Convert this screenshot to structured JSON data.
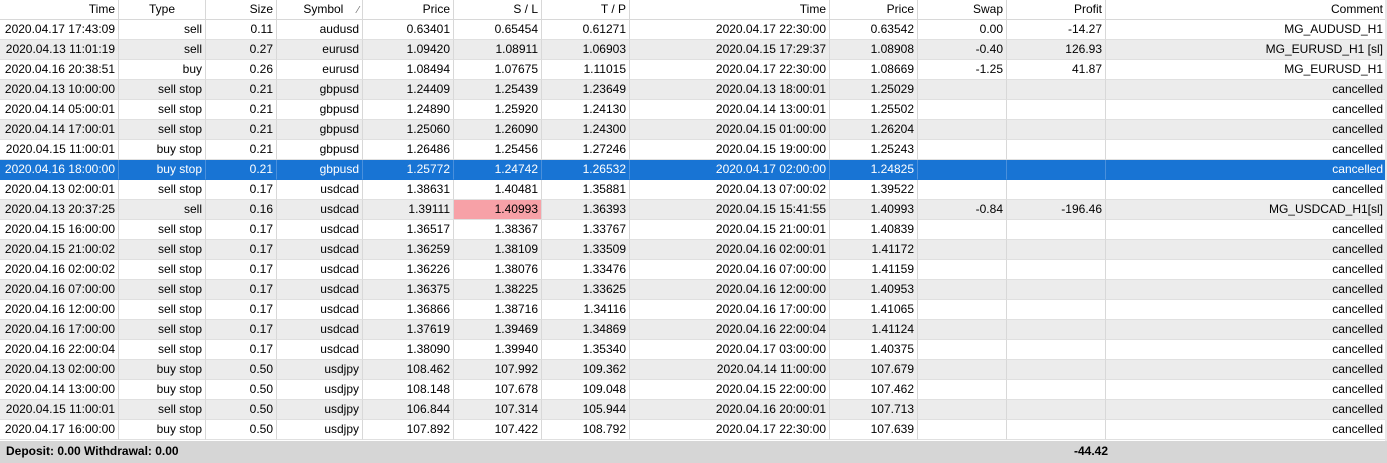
{
  "columns": [
    {
      "label": "Time",
      "w": 119
    },
    {
      "label": "Type",
      "w": 87
    },
    {
      "label": "Size",
      "w": 71
    },
    {
      "label": "Symbol",
      "w": 86
    },
    {
      "label": "Price",
      "w": 91
    },
    {
      "label": "S / L",
      "w": 88
    },
    {
      "label": "T / P",
      "w": 88
    },
    {
      "label": "Time",
      "w": 200
    },
    {
      "label": "Price",
      "w": 88
    },
    {
      "label": "Swap",
      "w": 89
    },
    {
      "label": "Profit",
      "w": 99
    },
    {
      "label": "Comment",
      "w": 281
    }
  ],
  "sort_indicator": "⁄",
  "rows": [
    [
      "2020.04.17 17:43:09",
      "sell",
      "0.11",
      "audusd",
      "0.63401",
      "0.65454",
      "0.61271",
      "2020.04.17 22:30:00",
      "0.63542",
      "0.00",
      "-14.27",
      "MG_AUDUSD_H1"
    ],
    [
      "2020.04.13 11:01:19",
      "sell",
      "0.27",
      "eurusd",
      "1.09420",
      "1.08911",
      "1.06903",
      "2020.04.15 17:29:37",
      "1.08908",
      "-0.40",
      "126.93",
      "MG_EURUSD_H1 [sl]"
    ],
    [
      "2020.04.16 20:38:51",
      "buy",
      "0.26",
      "eurusd",
      "1.08494",
      "1.07675",
      "1.11015",
      "2020.04.17 22:30:00",
      "1.08669",
      "-1.25",
      "41.87",
      "MG_EURUSD_H1"
    ],
    [
      "2020.04.13 10:00:00",
      "sell stop",
      "0.21",
      "gbpusd",
      "1.24409",
      "1.25439",
      "1.23649",
      "2020.04.13 18:00:01",
      "1.25029",
      "",
      "",
      "cancelled"
    ],
    [
      "2020.04.14 05:00:01",
      "sell stop",
      "0.21",
      "gbpusd",
      "1.24890",
      "1.25920",
      "1.24130",
      "2020.04.14 13:00:01",
      "1.25502",
      "",
      "",
      "cancelled"
    ],
    [
      "2020.04.14 17:00:01",
      "sell stop",
      "0.21",
      "gbpusd",
      "1.25060",
      "1.26090",
      "1.24300",
      "2020.04.15 01:00:00",
      "1.26204",
      "",
      "",
      "cancelled"
    ],
    [
      "2020.04.15 11:00:01",
      "buy stop",
      "0.21",
      "gbpusd",
      "1.26486",
      "1.25456",
      "1.27246",
      "2020.04.15 19:00:00",
      "1.25243",
      "",
      "",
      "cancelled"
    ],
    [
      "2020.04.16 18:00:00",
      "buy stop",
      "0.21",
      "gbpusd",
      "1.25772",
      "1.24742",
      "1.26532",
      "2020.04.17 02:00:00",
      "1.24825",
      "",
      "",
      "cancelled"
    ],
    [
      "2020.04.13 02:00:01",
      "sell stop",
      "0.17",
      "usdcad",
      "1.38631",
      "1.40481",
      "1.35881",
      "2020.04.13 07:00:02",
      "1.39522",
      "",
      "",
      "cancelled"
    ],
    [
      "2020.04.13 20:37:25",
      "sell",
      "0.16",
      "usdcad",
      "1.39111",
      "1.40993",
      "1.36393",
      "2020.04.15 15:41:55",
      "1.40993",
      "-0.84",
      "-196.46",
      "MG_USDCAD_H1[sl]"
    ],
    [
      "2020.04.15 16:00:00",
      "sell stop",
      "0.17",
      "usdcad",
      "1.36517",
      "1.38367",
      "1.33767",
      "2020.04.15 21:00:01",
      "1.40839",
      "",
      "",
      "cancelled"
    ],
    [
      "2020.04.15 21:00:02",
      "sell stop",
      "0.17",
      "usdcad",
      "1.36259",
      "1.38109",
      "1.33509",
      "2020.04.16 02:00:01",
      "1.41172",
      "",
      "",
      "cancelled"
    ],
    [
      "2020.04.16 02:00:02",
      "sell stop",
      "0.17",
      "usdcad",
      "1.36226",
      "1.38076",
      "1.33476",
      "2020.04.16 07:00:00",
      "1.41159",
      "",
      "",
      "cancelled"
    ],
    [
      "2020.04.16 07:00:00",
      "sell stop",
      "0.17",
      "usdcad",
      "1.36375",
      "1.38225",
      "1.33625",
      "2020.04.16 12:00:00",
      "1.40953",
      "",
      "",
      "cancelled"
    ],
    [
      "2020.04.16 12:00:00",
      "sell stop",
      "0.17",
      "usdcad",
      "1.36866",
      "1.38716",
      "1.34116",
      "2020.04.16 17:00:00",
      "1.41065",
      "",
      "",
      "cancelled"
    ],
    [
      "2020.04.16 17:00:00",
      "sell stop",
      "0.17",
      "usdcad",
      "1.37619",
      "1.39469",
      "1.34869",
      "2020.04.16 22:00:04",
      "1.41124",
      "",
      "",
      "cancelled"
    ],
    [
      "2020.04.16 22:00:04",
      "sell stop",
      "0.17",
      "usdcad",
      "1.38090",
      "1.39940",
      "1.35340",
      "2020.04.17 03:00:00",
      "1.40375",
      "",
      "",
      "cancelled"
    ],
    [
      "2020.04.13 02:00:00",
      "buy stop",
      "0.50",
      "usdjpy",
      "108.462",
      "107.992",
      "109.362",
      "2020.04.14 11:00:00",
      "107.679",
      "",
      "",
      "cancelled"
    ],
    [
      "2020.04.14 13:00:00",
      "buy stop",
      "0.50",
      "usdjpy",
      "108.148",
      "107.678",
      "109.048",
      "2020.04.15 22:00:00",
      "107.462",
      "",
      "",
      "cancelled"
    ],
    [
      "2020.04.15 11:00:01",
      "sell stop",
      "0.50",
      "usdjpy",
      "106.844",
      "107.314",
      "105.944",
      "2020.04.16 20:00:01",
      "107.713",
      "",
      "",
      "cancelled"
    ],
    [
      "2020.04.17 16:00:00",
      "buy stop",
      "0.50",
      "usdjpy",
      "107.892",
      "107.422",
      "108.792",
      "2020.04.17 22:30:00",
      "107.639",
      "",
      "",
      "cancelled"
    ]
  ],
  "selected_row": 7,
  "highlight_cell": {
    "row": 9,
    "col": 5,
    "color": "#f7a1a7"
  },
  "accent_color": "#1874d4",
  "footer": {
    "summary": "Deposit: 0.00  Withdrawal: 0.00",
    "profit_total": "-44.42"
  }
}
